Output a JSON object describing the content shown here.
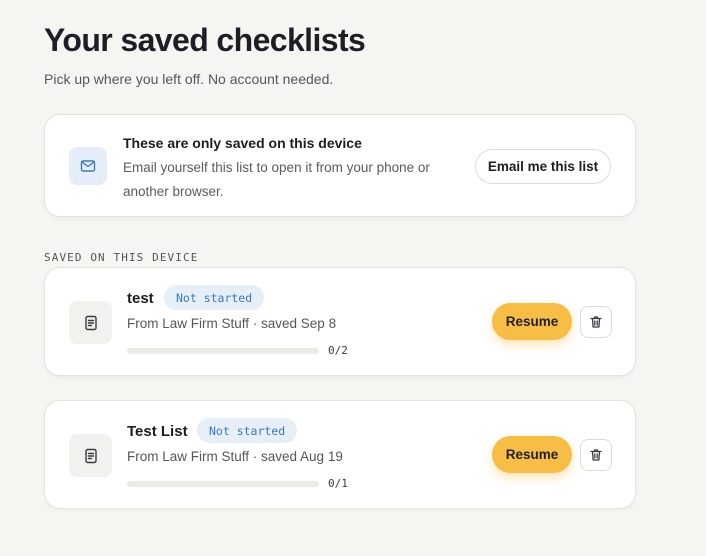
{
  "header": {
    "title": "Your saved checklists",
    "subtitle": "Pick up where you left off. No account needed."
  },
  "notice": {
    "icon": "mail-icon",
    "title": "These are only saved on this device",
    "body": "Email yourself this list to open it from your phone or another browser.",
    "button_label": "Email me this list"
  },
  "section": {
    "label": "SAVED ON THIS DEVICE"
  },
  "checklists": [
    {
      "name": "test",
      "status": "Not started",
      "meta": "From Law Firm Stuff · saved Sep 8",
      "progress_done": 0,
      "progress_total": 2,
      "progress_label": "0/2",
      "resume_label": "Resume"
    },
    {
      "name": "Test List",
      "status": "Not started",
      "meta": "From Law Firm Stuff · saved Aug 19",
      "progress_done": 0,
      "progress_total": 1,
      "progress_label": "0/1",
      "resume_label": "Resume"
    }
  ],
  "colors": {
    "accent": "#f8bd44",
    "badge_bg": "#e6eff8",
    "badge_text": "#3e79b8",
    "page_bg": "#f5f5f1"
  }
}
